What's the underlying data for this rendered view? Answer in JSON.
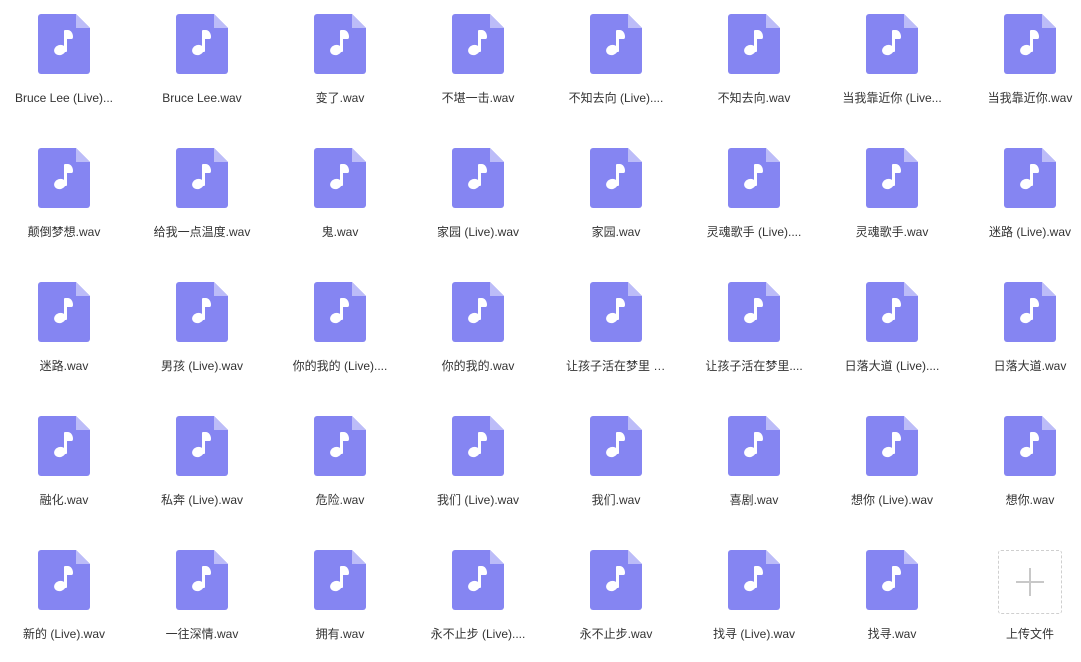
{
  "files": [
    "Bruce Lee (Live)...",
    "Bruce Lee.wav",
    "变了.wav",
    "不堪一击.wav",
    "不知去向 (Live)....",
    "不知去向.wav",
    "当我靠近你 (Live...",
    "当我靠近你.wav",
    "颠倒梦想.wav",
    "给我一点温度.wav",
    "鬼.wav",
    "家园 (Live).wav",
    "家园.wav",
    "灵魂歌手 (Live)....",
    "灵魂歌手.wav",
    "迷路 (Live).wav",
    "迷路.wav",
    "男孩 (Live).wav",
    "你的我的 (Live)....",
    "你的我的.wav",
    "让孩子活在梦里 (...",
    "让孩子活在梦里....",
    "日落大道 (Live)....",
    "日落大道.wav",
    "融化.wav",
    "私奔 (Live).wav",
    "危险.wav",
    "我们 (Live).wav",
    "我们.wav",
    "喜剧.wav",
    "想你 (Live).wav",
    "想你.wav",
    "新的 (Live).wav",
    "一往深情.wav",
    "拥有.wav",
    "永不止步 (Live)....",
    "永不止步.wav",
    "找寻 (Live).wav",
    "找寻.wav"
  ],
  "upload": {
    "label": "上传文件",
    "icon": "plus-icon"
  },
  "icons": {
    "file": "audio-file-icon",
    "note": "music-note-icon"
  },
  "colors": {
    "icon_fill": "#8585f2",
    "icon_fold": "#bcbcf8",
    "label_text": "#333333",
    "upload_border": "#cfcfcf"
  }
}
